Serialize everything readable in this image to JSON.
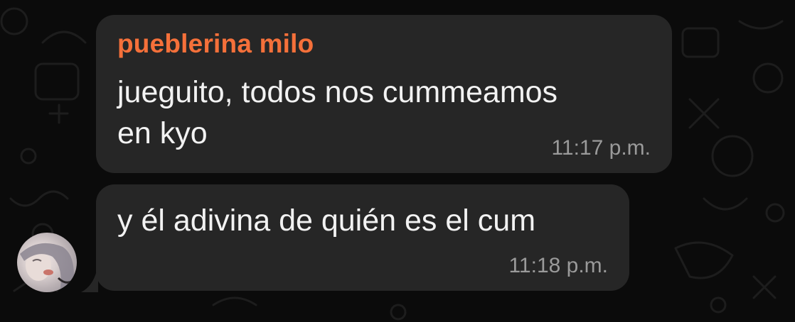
{
  "chat": {
    "messages": [
      {
        "sender": "pueblerina milo",
        "lines": [
          "jueguito, todos nos cummeamos",
          "en kyo"
        ],
        "time": "11:17 p.m."
      },
      {
        "lines": [
          "y él adivina de quién es el cum"
        ],
        "time": "11:18 p.m."
      }
    ],
    "avatar_icon": "user-avatar-photo"
  },
  "colors": {
    "background": "#0b0b0b",
    "bubble": "#262626",
    "sender_name": "#f5703a",
    "message_text": "#f2f2f2",
    "timestamp": "#9a9a9a"
  }
}
